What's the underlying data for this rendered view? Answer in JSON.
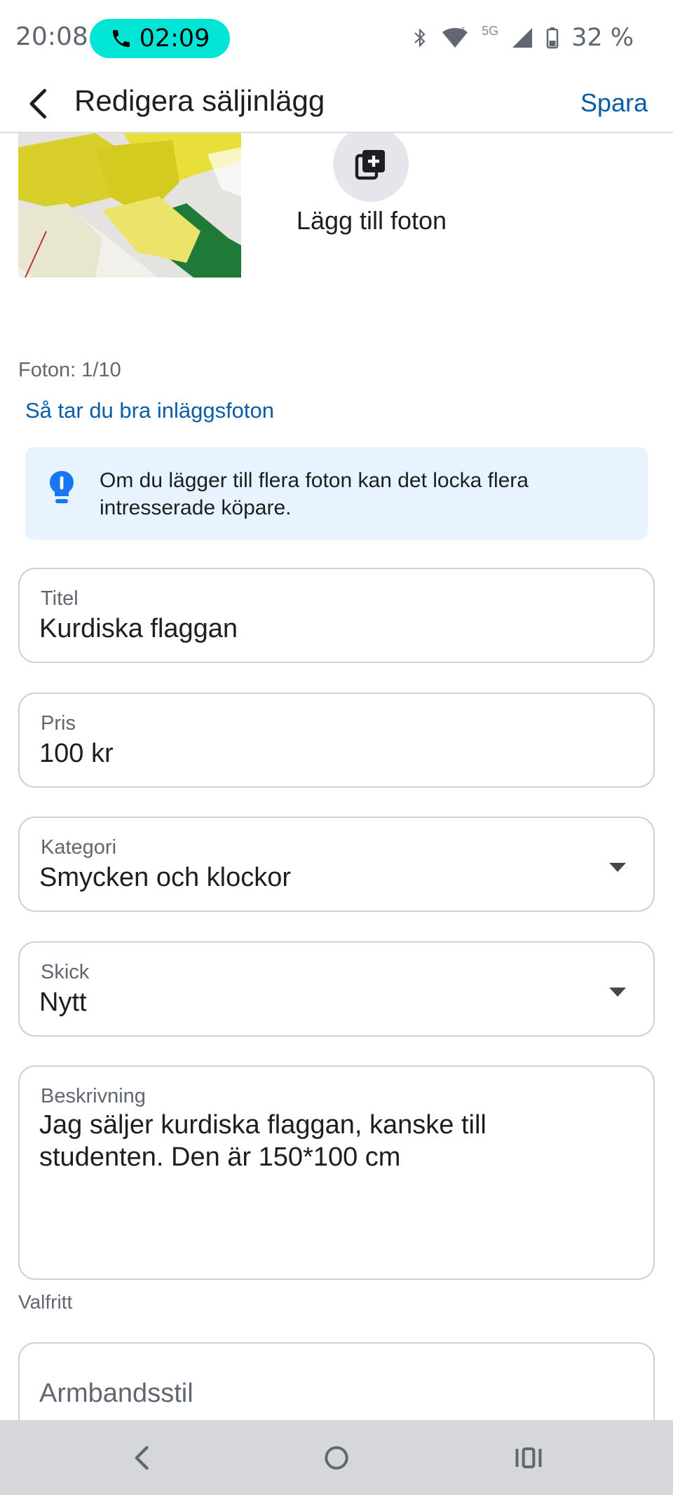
{
  "status_bar": {
    "time": "20:08",
    "call_timer": "02:09",
    "network": "5G",
    "battery": "32 %",
    "call_color": "#00e5d6"
  },
  "header": {
    "title": "Redigera säljinlägg",
    "save_label": "Spara"
  },
  "photos": {
    "add_label": "Lägg till foton",
    "count": "Foton: 1/10",
    "tips_link": "Så tar du bra inläggsfoton"
  },
  "tip": {
    "text": "Om du lägger till flera foton kan det locka flera intresserade köpare."
  },
  "fields": {
    "title": {
      "label": "Titel",
      "value": "Kurdiska flaggan"
    },
    "price": {
      "label": "Pris",
      "value": "100 kr"
    },
    "category": {
      "label": "Kategori",
      "value": "Smycken och klockor"
    },
    "condition": {
      "label": "Skick",
      "value": "Nytt"
    },
    "description": {
      "label": "Beskrivning",
      "value": "Jag säljer kurdiska flaggan, kanske till studenten. Den är 150*100 cm",
      "note": "Valfritt"
    },
    "bracelet_style": {
      "placeholder": "Armbandsstil"
    }
  },
  "colors": {
    "link": "#0a5ca6",
    "tip_background": "#e7f3ff",
    "field_border": "#ced0d4",
    "nav_background": "#d6d7db"
  }
}
